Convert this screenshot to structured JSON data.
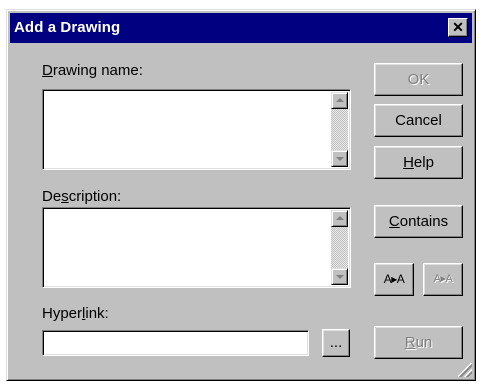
{
  "dialog": {
    "title": "Add a Drawing",
    "close_symbol": "✕"
  },
  "drawing_name": {
    "label_u": "D",
    "label_rest": "rawing name:",
    "value": ""
  },
  "description": {
    "label_pre": "De",
    "label_u": "s",
    "label_rest": "cription:",
    "value": ""
  },
  "hyperlink": {
    "label_pre": "Hyper",
    "label_u": "l",
    "label_rest": "ink:",
    "value": "",
    "browse_label": "..."
  },
  "buttons": {
    "ok": "OK",
    "cancel": "Cancel",
    "help_u": "H",
    "help_rest": "elp",
    "contains_u": "C",
    "contains_rest": "ontains",
    "font_larger": "A▸A",
    "font_smaller": "A▸A",
    "run_u": "R",
    "run_rest": "un"
  },
  "icons": {
    "close": "close-icon",
    "scroll_up": "scroll-up-arrow-icon",
    "scroll_down": "scroll-down-arrow-icon",
    "resize_grip": "resize-grip-icon"
  },
  "colors": {
    "titlebar": "#000080",
    "face": "#c0c0c0",
    "disabled_text": "#808080"
  }
}
